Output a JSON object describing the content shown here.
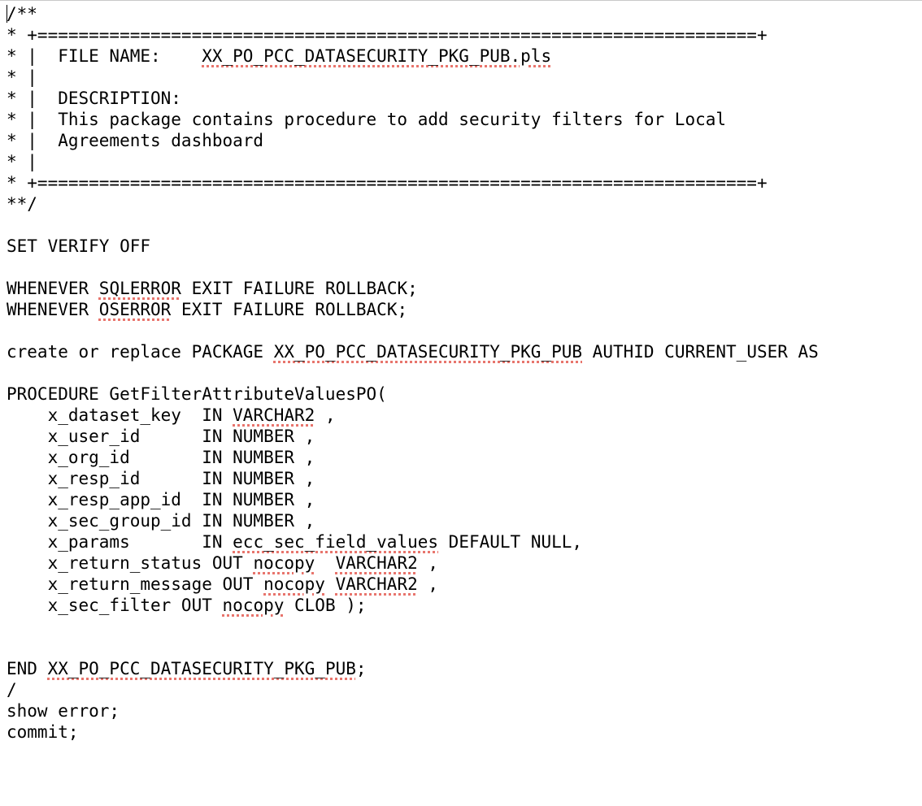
{
  "editor": {
    "lines": [
      {
        "segments": [
          {
            "text": "/**"
          }
        ],
        "caret": true
      },
      {
        "segments": [
          {
            "text": "* +======================================================================+"
          }
        ]
      },
      {
        "segments": [
          {
            "text": "* |  FILE NAME:    "
          },
          {
            "text": "XX_PO_PCC_DATASECURITY_PKG_PUB.pls",
            "flag": true
          }
        ]
      },
      {
        "segments": [
          {
            "text": "* |"
          }
        ]
      },
      {
        "segments": [
          {
            "text": "* |  DESCRIPTION:"
          }
        ]
      },
      {
        "segments": [
          {
            "text": "* |  This package contains procedure to add security filters for Local"
          }
        ]
      },
      {
        "segments": [
          {
            "text": "* |  Agreements dashboard"
          }
        ]
      },
      {
        "segments": [
          {
            "text": "* |"
          }
        ]
      },
      {
        "segments": [
          {
            "text": "* +======================================================================+"
          }
        ]
      },
      {
        "segments": [
          {
            "text": "**/"
          }
        ]
      },
      {
        "segments": [
          {
            "text": ""
          }
        ]
      },
      {
        "segments": [
          {
            "text": "SET VERIFY OFF"
          }
        ]
      },
      {
        "segments": [
          {
            "text": ""
          }
        ]
      },
      {
        "segments": [
          {
            "text": "WHENEVER "
          },
          {
            "text": "SQLERROR",
            "flag": true
          },
          {
            "text": " EXIT FAILURE ROLLBACK;"
          }
        ]
      },
      {
        "segments": [
          {
            "text": "WHENEVER "
          },
          {
            "text": "OSERROR",
            "flag": true
          },
          {
            "text": " EXIT FAILURE ROLLBACK;"
          }
        ]
      },
      {
        "segments": [
          {
            "text": ""
          }
        ]
      },
      {
        "segments": [
          {
            "text": "create or replace PACKAGE "
          },
          {
            "text": "XX_PO_PCC_DATASECURITY_PKG_PUB",
            "flag": true
          },
          {
            "text": " AUTHID CURRENT_USER AS"
          }
        ]
      },
      {
        "segments": [
          {
            "text": ""
          }
        ]
      },
      {
        "segments": [
          {
            "text": "PROCEDURE GetFilterAttributeValuesPO("
          }
        ]
      },
      {
        "segments": [
          {
            "text": "    x_dataset_key  IN "
          },
          {
            "text": "VARCHAR2",
            "flag": true
          },
          {
            "text": " ,"
          }
        ]
      },
      {
        "segments": [
          {
            "text": "    x_user_id      IN NUMBER ,"
          }
        ]
      },
      {
        "segments": [
          {
            "text": "    x_org_id       IN NUMBER ,"
          }
        ]
      },
      {
        "segments": [
          {
            "text": "    x_resp_id      IN NUMBER ,"
          }
        ]
      },
      {
        "segments": [
          {
            "text": "    x_resp_app_id  IN NUMBER ,"
          }
        ]
      },
      {
        "segments": [
          {
            "text": "    x_sec_group_id IN NUMBER ,"
          }
        ]
      },
      {
        "segments": [
          {
            "text": "    x_params       IN "
          },
          {
            "text": "ecc_sec_field_values",
            "flag": true
          },
          {
            "text": " DEFAULT NULL,"
          }
        ]
      },
      {
        "segments": [
          {
            "text": "    x_return_status OUT "
          },
          {
            "text": "nocopy",
            "flag": true
          },
          {
            "text": "  "
          },
          {
            "text": "VARCHAR2",
            "flag": true
          },
          {
            "text": " ,"
          }
        ]
      },
      {
        "segments": [
          {
            "text": "    x_return_message OUT "
          },
          {
            "text": "nocopy",
            "flag": true
          },
          {
            "text": " "
          },
          {
            "text": "VARCHAR2",
            "flag": true
          },
          {
            "text": " ,"
          }
        ]
      },
      {
        "segments": [
          {
            "text": "    x_sec_filter OUT "
          },
          {
            "text": "nocopy",
            "flag": true
          },
          {
            "text": " CLOB );"
          }
        ]
      },
      {
        "segments": [
          {
            "text": ""
          }
        ]
      },
      {
        "segments": [
          {
            "text": ""
          }
        ]
      },
      {
        "segments": [
          {
            "text": "END "
          },
          {
            "text": "XX_PO_PCC_DATASECURITY_PKG_PUB",
            "flag": true
          },
          {
            "text": ";"
          }
        ]
      },
      {
        "segments": [
          {
            "text": "/"
          }
        ]
      },
      {
        "segments": [
          {
            "text": "show error;"
          }
        ]
      },
      {
        "segments": [
          {
            "text": "commit;"
          }
        ]
      }
    ]
  },
  "colors": {
    "background": "#ffffff",
    "text": "#000000",
    "spellcheck_underline": "#e8756d"
  }
}
